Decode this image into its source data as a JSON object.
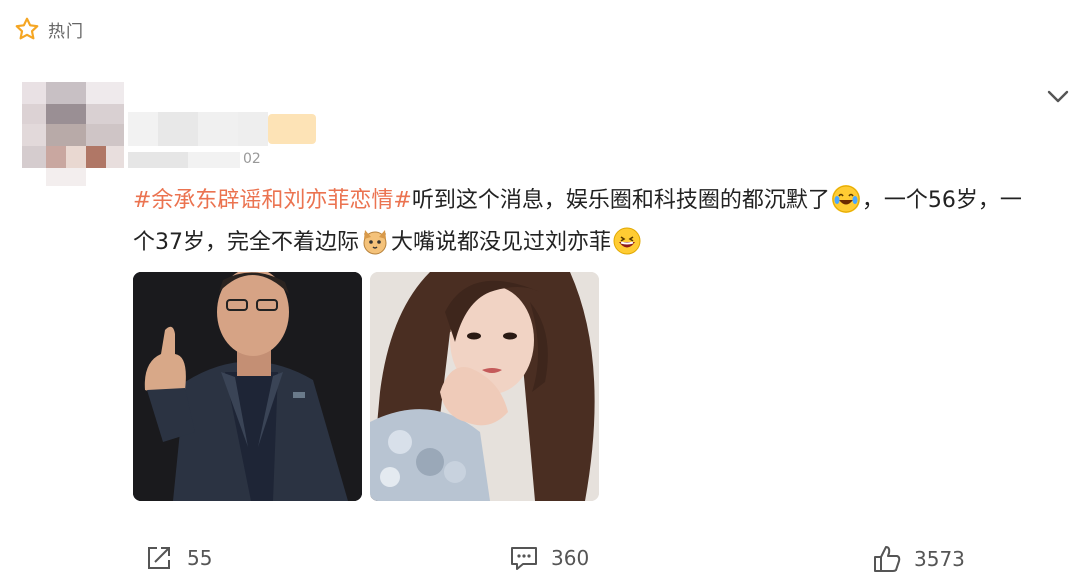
{
  "hot_tag": {
    "label": "热门"
  },
  "post": {
    "time_fragment": "02",
    "hashtag": "#余承东辟谣和刘亦菲恋情#",
    "text_part1": "听到这个消息，娱乐圈和科技圈的都沉默了",
    "text_part2": "，一个56岁，一个37岁，完全不着边际",
    "text_part3": "大嘴说都没见过刘亦菲",
    "icons": [
      "tears-of-joy-emoji",
      "cat-face-emoji",
      "laughing-emoji"
    ]
  },
  "actions": {
    "share_count": "55",
    "comment_count": "360",
    "like_count": "3573"
  },
  "colors": {
    "hashtag": "#eb7350",
    "star": "#f5a623"
  }
}
